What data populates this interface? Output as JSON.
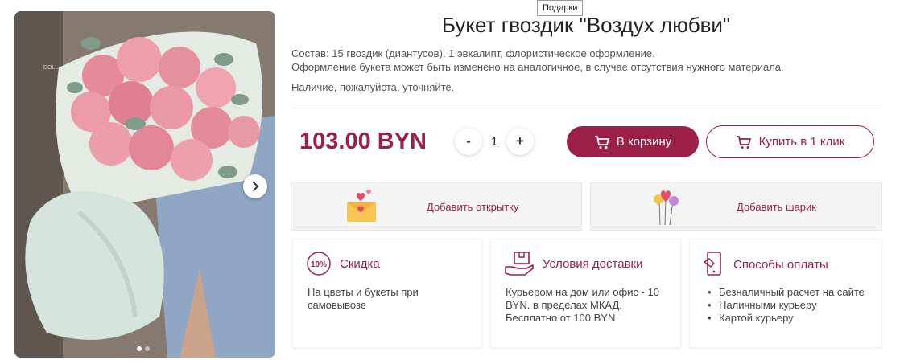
{
  "tooltip": "Подарки",
  "product": {
    "title": "Букет гвоздик \"Воздух любви\"",
    "composition": "Состав: 15 гвоздик (диантусов), 1 эвкалипт, флористическое оформление.",
    "note_material": "Оформление букета может быть изменено на аналогичное, в случае отсутствия нужного материала.",
    "note_availability": "Наличие, пожалуйста, уточняйте.",
    "price": "103.00 BYN",
    "image_watermark": "DOLL"
  },
  "quantity": {
    "minus": "-",
    "value": "1",
    "plus": "+"
  },
  "buttons": {
    "cart": "В корзину",
    "one_click": "Купить в 1 клик"
  },
  "addons": {
    "card": "Добавить открытку",
    "balloon": "Добавить шарик"
  },
  "info": {
    "discount": {
      "badge": "10%",
      "title": "Скидка",
      "text": "На цветы и букеты при самовывозе"
    },
    "delivery": {
      "title": "Условия доставки",
      "text": "Курьером на дом или офис - 10 BYN. в пределах МКАД. Бесплатно от 100 BYN"
    },
    "payment": {
      "title": "Способы оплаты",
      "items": [
        "Безналичный расчет на сайте",
        "Наличными курьеру",
        "Картой курьеру"
      ]
    }
  },
  "gallery": {
    "slides": 2,
    "active": 1
  },
  "colors": {
    "accent": "#9c1f47",
    "addon_bg": "#f4f4f4"
  },
  "icons": {
    "next": "chevron-right-icon",
    "cart": "shopping-cart-icon",
    "card": "love-letter-icon",
    "balloon": "balloons-icon",
    "discount": "percent-badge-icon",
    "delivery": "delivery-hand-icon",
    "payment": "phone-payment-icon"
  }
}
